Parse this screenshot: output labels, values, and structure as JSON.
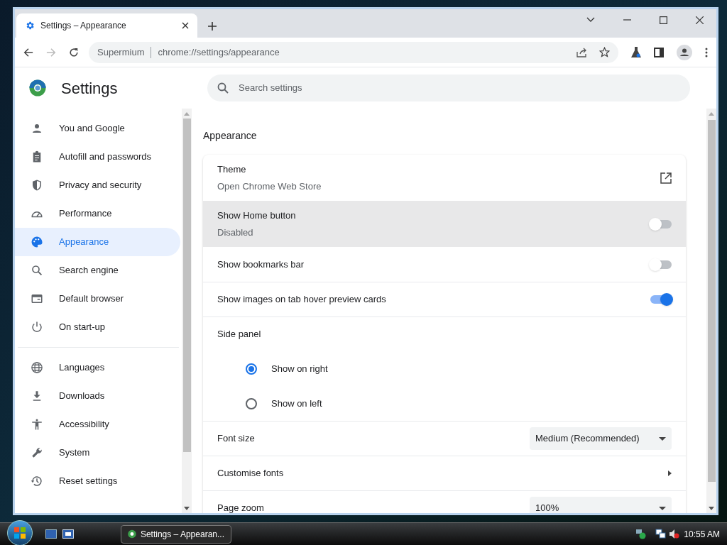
{
  "browser": {
    "tab": {
      "title": "Settings – Appearance"
    },
    "address": {
      "site": "Supermium",
      "url": "chrome://settings/appearance"
    }
  },
  "settings": {
    "title": "Settings",
    "search": {
      "placeholder": "Search settings"
    },
    "nav_groups": [
      [
        {
          "label": "You and Google",
          "selected": false
        },
        {
          "label": "Autofill and passwords",
          "selected": false
        },
        {
          "label": "Privacy and security",
          "selected": false
        },
        {
          "label": "Performance",
          "selected": false
        },
        {
          "label": "Appearance",
          "selected": true
        },
        {
          "label": "Search engine",
          "selected": false
        },
        {
          "label": "Default browser",
          "selected": false
        },
        {
          "label": "On start-up",
          "selected": false
        }
      ],
      [
        {
          "label": "Languages",
          "selected": false
        },
        {
          "label": "Downloads",
          "selected": false
        },
        {
          "label": "Accessibility",
          "selected": false
        },
        {
          "label": "System",
          "selected": false
        },
        {
          "label": "Reset settings",
          "selected": false
        }
      ]
    ],
    "section_title": "Appearance",
    "rows": [
      {
        "kind": "link",
        "label": "Theme",
        "sublabel": "Open Chrome Web Store"
      },
      {
        "kind": "toggle",
        "label": "Show Home button",
        "sublabel": "Disabled",
        "on": false,
        "hovered": true
      },
      {
        "kind": "toggle",
        "label": "Show bookmarks bar",
        "on": false
      },
      {
        "kind": "toggle",
        "label": "Show images on tab hover preview cards",
        "on": true
      },
      {
        "kind": "heading",
        "label": "Side panel"
      },
      {
        "kind": "radio",
        "label": "Show on right",
        "selected": true
      },
      {
        "kind": "radio",
        "label": "Show on left",
        "selected": false
      },
      {
        "kind": "dropdown",
        "label": "Font size",
        "value": "Medium (Recommended)"
      },
      {
        "kind": "submenu",
        "label": "Customise fonts"
      },
      {
        "kind": "dropdown",
        "label": "Page zoom",
        "value": "100%"
      }
    ]
  },
  "taskbar": {
    "window_button": "Settings – Appearan...",
    "clock": "10:55 AM"
  }
}
